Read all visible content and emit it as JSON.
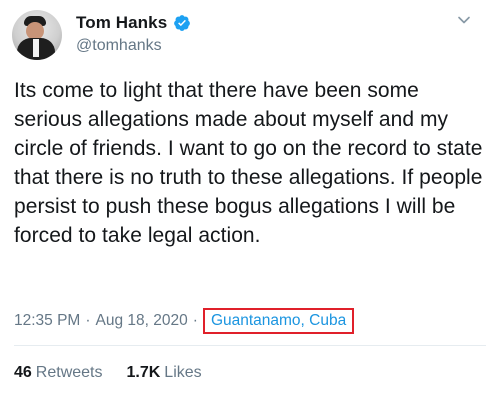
{
  "author": {
    "display_name": "Tom Hanks",
    "handle": "@tomhanks"
  },
  "tweet": {
    "text": "Its come to light that there have been some serious allegations made about myself and my circle of friends. I want to go on the record to state that there is no truth to these allegations. If people persist to push these bogus allegations I will be forced to take legal action."
  },
  "meta": {
    "time": "12:35 PM",
    "separator": "·",
    "date": "Aug 18, 2020",
    "location": "Guantanamo, Cuba"
  },
  "stats": {
    "retweets_count": "46",
    "retweets_label": "Retweets",
    "likes_count": "1.7K",
    "likes_label": "Likes"
  },
  "colors": {
    "verified_badge": "#1da1f2",
    "link": "#1b95e0",
    "highlight_box": "#e0202a",
    "secondary_text": "#657786"
  },
  "icons": {
    "verified": "verified-badge-icon",
    "menu": "chevron-down-icon"
  }
}
